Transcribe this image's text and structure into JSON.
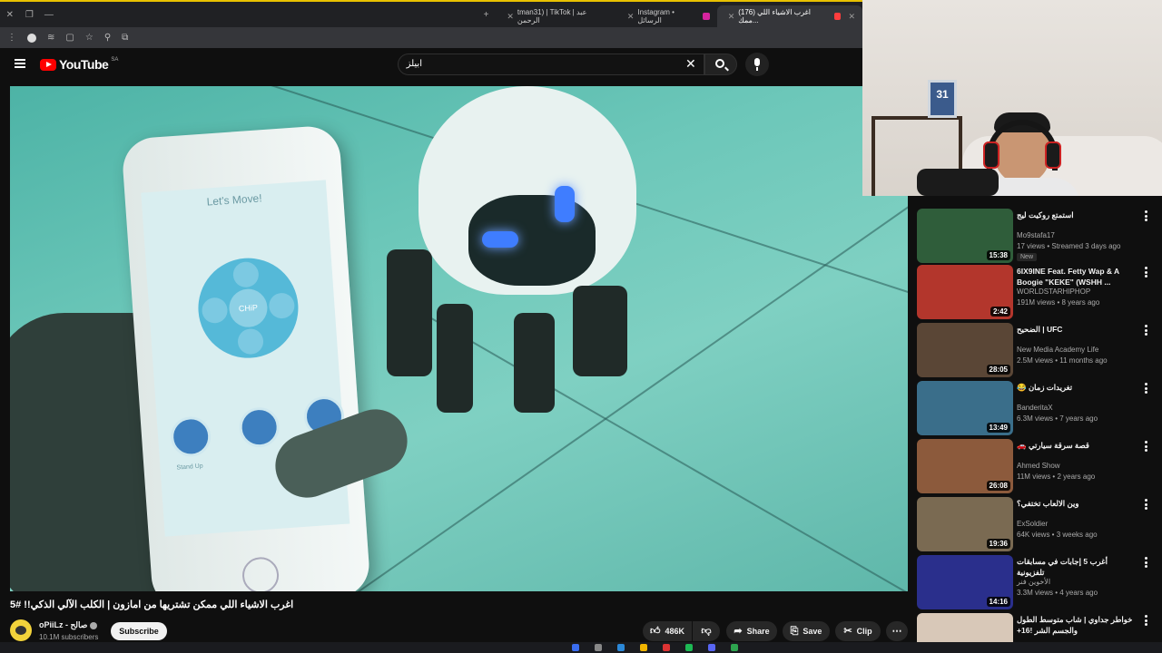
{
  "browser": {
    "tabs": [
      {
        "label": "Instagram • الرسائل",
        "active": false
      },
      {
        "label": "(176) اغرب الاشياء اللي ممك...",
        "active": true
      }
    ],
    "tab_partial_label": "tman31) | TikTok | عبد الرحمن"
  },
  "header": {
    "logo_text": "YouTube",
    "country_code": "SA",
    "search_value": "ابيلز"
  },
  "video": {
    "phone_screen_title": "Let's Move!",
    "dpad_label": "CHiP",
    "action_label": "Stand Up",
    "frame_number": "31",
    "title": "اغرب الاشياء اللي ممكن تشتريها من امازون | الكلب الآلي الذكي!! #5",
    "channel_name": "oPiiLz - صالح",
    "subscribers": "10.1M subscribers",
    "subscribe_label": "Subscribe",
    "likes": "486K",
    "share_label": "Share",
    "save_label": "Save",
    "clip_label": "Clip"
  },
  "sidebar": {
    "items": [
      {
        "title": "استمتع روكيت ليج",
        "channel": "Mo9stafa17",
        "meta": "17 views • Streamed 3 days ago",
        "badge": "New",
        "duration": "15:38",
        "thumb_color": "#2f5d3a",
        "rtl": true
      },
      {
        "title": "6IX9INE Feat. Fetty Wap & A Boogie \"KEKE\" (WSHH ...",
        "channel": "WORLDSTARHIPHOP",
        "meta": "191M views • 8 years ago",
        "badge": "",
        "duration": "2:42",
        "thumb_color": "#b3362c",
        "rtl": false
      },
      {
        "title": "UFC | الضحيح",
        "channel": "New Media Academy Life",
        "meta": "2.5M views • 11 months ago",
        "badge": "",
        "duration": "28:05",
        "thumb_color": "#5a4636",
        "rtl": true
      },
      {
        "title": "تغريدات زمان 😂",
        "channel": "BanderitaX",
        "meta": "6.3M views • 7 years ago",
        "badge": "",
        "duration": "13:49",
        "thumb_color": "#3a6e8a",
        "rtl": true
      },
      {
        "title": "قصة سرقة سيارتي 🚗",
        "channel": "Ahmed Show",
        "meta": "11M views • 2 years ago",
        "badge": "",
        "duration": "26:08",
        "thumb_color": "#8c5a3c",
        "rtl": true
      },
      {
        "title": "وين الالعاب تختفي؟",
        "channel": "ExSoldier",
        "meta": "64K views • 3 weeks ago",
        "badge": "",
        "duration": "19:36",
        "thumb_color": "#7a6a52",
        "rtl": true
      },
      {
        "title": "أغرب 5 إجابات في مسابقات تلفزيونية",
        "channel": "الأخوين فنر",
        "meta": "3.3M views • 4 years ago",
        "badge": "",
        "duration": "14:16",
        "thumb_color": "#2a2f8c",
        "rtl": true
      },
      {
        "title": "خواطر جداوي | شاب متوسط الطول والجسم الشر !16+",
        "channel": "",
        "meta": "",
        "badge": "",
        "duration": "",
        "thumb_color": "#d8c8b8",
        "rtl": true
      }
    ]
  },
  "colors": {
    "accent": "#ff0000",
    "background": "#0f0f0f",
    "video_tint": "#6cc7b9"
  }
}
